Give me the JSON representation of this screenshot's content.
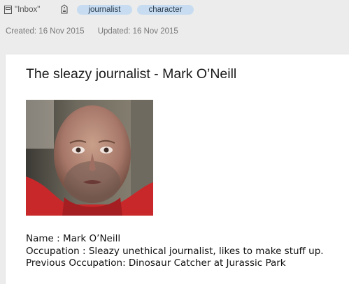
{
  "toolbar": {
    "notebook_icon": "notebook-icon",
    "notebook_name": "\"Inbox\"",
    "tag_icon": "tag-icon",
    "tags": [
      "journalist",
      "character"
    ]
  },
  "meta": {
    "created": "Created: 16 Nov 2015",
    "updated": "Updated: 16 Nov 2015"
  },
  "note": {
    "title": "The sleazy journalist - Mark O’Neill",
    "lines": [
      "Name : Mark O’Neill",
      "Occupation : Sleazy unethical journalist, likes to make stuff up.",
      "Previous Occupation: Dinosaur Catcher at Jurassic Park"
    ]
  },
  "colors": {
    "tag_background": "#c7dcf0",
    "page_background": "#ececec",
    "note_background": "#ffffff"
  }
}
